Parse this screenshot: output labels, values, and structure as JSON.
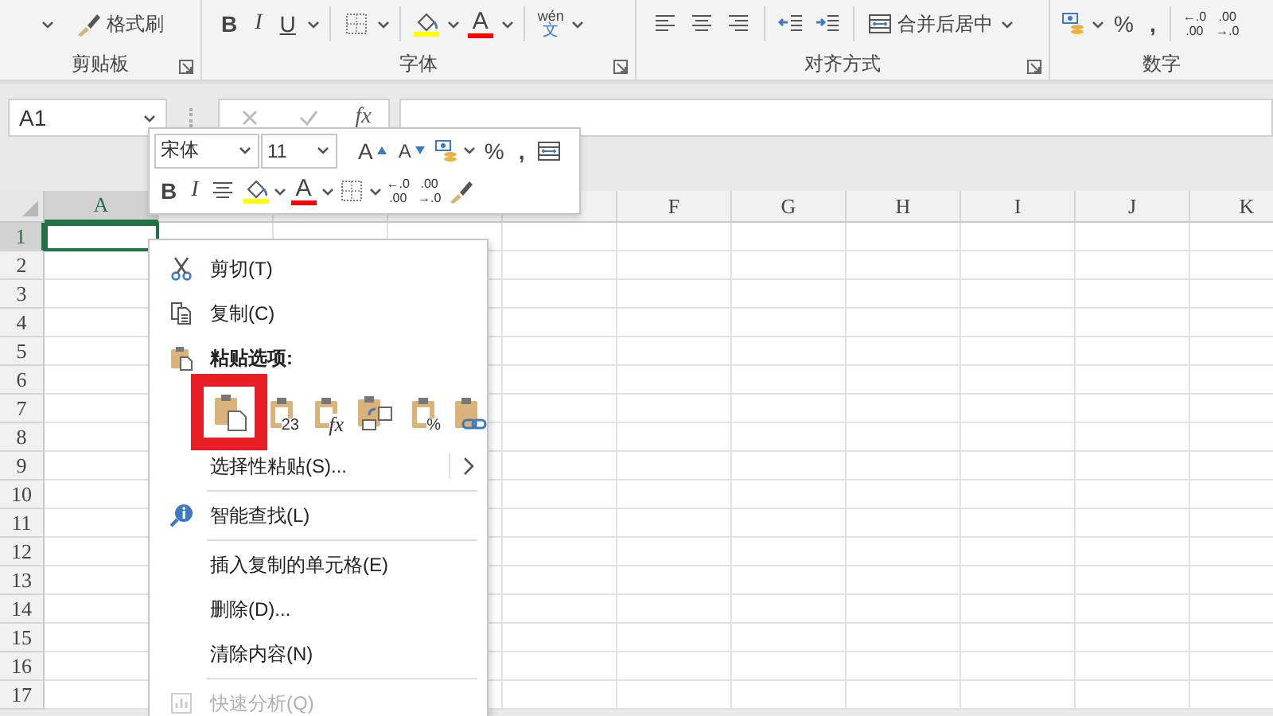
{
  "ribbon": {
    "groups": [
      {
        "label": "剪贴板",
        "launcher": true,
        "tools": [
          {
            "kind": "caret"
          },
          {
            "kind": "brush",
            "text": "格式刷"
          }
        ]
      },
      {
        "label": "字体",
        "launcher": true,
        "tools": [
          {
            "kind": "bold",
            "text": "B"
          },
          {
            "kind": "italic",
            "text": "I"
          },
          {
            "kind": "underline",
            "text": "U"
          },
          {
            "kind": "caret"
          },
          {
            "kind": "sep"
          },
          {
            "kind": "borders"
          },
          {
            "kind": "caret"
          },
          {
            "kind": "sep"
          },
          {
            "kind": "fill",
            "color": "#ffff00"
          },
          {
            "kind": "caret"
          },
          {
            "kind": "fontcolor",
            "text": "A",
            "color": "#ff0000"
          },
          {
            "kind": "caret"
          },
          {
            "kind": "sep"
          },
          {
            "kind": "phonetic",
            "text": "wén",
            "sub": "文"
          },
          {
            "kind": "caret"
          }
        ]
      },
      {
        "label": "对齐方式",
        "launcher": true,
        "tools": [
          {
            "kind": "align-left"
          },
          {
            "kind": "align-center"
          },
          {
            "kind": "align-right"
          },
          {
            "kind": "sep"
          },
          {
            "kind": "outdent"
          },
          {
            "kind": "indent"
          },
          {
            "kind": "sep"
          },
          {
            "kind": "merge",
            "text": "合并后居中"
          },
          {
            "kind": "caret"
          }
        ]
      },
      {
        "label": "数字",
        "launcher": false,
        "tools": [
          {
            "kind": "numformat"
          },
          {
            "kind": "caret"
          },
          {
            "kind": "percent",
            "text": "%"
          },
          {
            "kind": "comma",
            "text": ","
          },
          {
            "kind": "sep"
          },
          {
            "kind": "decimal",
            "top": "←.0",
            "bottom": ".00"
          },
          {
            "kind": "decimal",
            "top": ".00",
            "bottom": "→.0"
          }
        ]
      }
    ]
  },
  "formula_bar": {
    "name_box": "A1",
    "function_label": "fx"
  },
  "mini_toolbar": {
    "top_row": [
      {
        "kind": "combo",
        "text": "宋体"
      },
      {
        "kind": "combo",
        "text": "11"
      },
      {
        "kind": "grow",
        "text": "A"
      },
      {
        "kind": "shrink",
        "text": "A"
      },
      {
        "kind": "numformat"
      },
      {
        "kind": "caret"
      },
      {
        "kind": "percent",
        "text": "%"
      },
      {
        "kind": "comma",
        "text": ","
      },
      {
        "kind": "wrap"
      }
    ],
    "bottom_row": [
      {
        "kind": "bold",
        "text": "B"
      },
      {
        "kind": "italic",
        "text": "I"
      },
      {
        "kind": "align-center"
      },
      {
        "kind": "fill",
        "color": "#ffff00"
      },
      {
        "kind": "caret"
      },
      {
        "kind": "fontcolor",
        "text": "A",
        "color": "#ff0000"
      },
      {
        "kind": "caret"
      },
      {
        "kind": "borders"
      },
      {
        "kind": "caret"
      },
      {
        "kind": "decimal",
        "top": "←.0",
        "bottom": ".00"
      },
      {
        "kind": "decimal",
        "top": ".00",
        "bottom": "→.0"
      },
      {
        "kind": "brush"
      }
    ]
  },
  "sheet": {
    "columns": [
      {
        "label": "A",
        "selected": true
      },
      {
        "selected": false
      },
      {
        "selected": false
      },
      {
        "selected": false
      },
      {
        "selected": false
      },
      {
        "label": "F",
        "selected": false
      },
      {
        "label": "G",
        "selected": false
      },
      {
        "label": "H",
        "selected": false
      },
      {
        "label": "I",
        "selected": false
      },
      {
        "label": "J",
        "selected": false
      },
      {
        "label": "K",
        "selected": false
      }
    ],
    "rows": [
      {
        "label": "1",
        "selected": true
      },
      {
        "label": "2",
        "selected": false
      },
      {
        "label": "3",
        "selected": false
      },
      {
        "label": "4",
        "selected": false
      },
      {
        "label": "5",
        "selected": false
      },
      {
        "label": "6",
        "selected": false
      },
      {
        "label": "7",
        "selected": false
      },
      {
        "label": "8",
        "selected": false
      },
      {
        "label": "9",
        "selected": false
      },
      {
        "label": "10",
        "selected": false
      },
      {
        "label": "11",
        "selected": false
      },
      {
        "label": "12",
        "selected": false
      },
      {
        "label": "13",
        "selected": false
      },
      {
        "label": "14",
        "selected": false
      },
      {
        "label": "15",
        "selected": false
      },
      {
        "label": "16",
        "selected": false
      },
      {
        "label": "17",
        "selected": false
      }
    ]
  },
  "context_menu": {
    "items": [
      {
        "kind": "cut",
        "text": "剪切(T)",
        "submenu": false,
        "disabled": false
      },
      {
        "kind": "copy",
        "text": "复制(C)",
        "submenu": false,
        "disabled": false
      },
      {
        "kind": "heading",
        "text": "粘贴选项:"
      },
      {
        "kind": "paste_options",
        "options": [
          {
            "kind": "paste",
            "highlighted": true
          },
          {
            "kind": "values",
            "text": "23",
            "highlighted": false
          },
          {
            "kind": "formulas",
            "text": "fx",
            "highlighted": false
          },
          {
            "kind": "transpose",
            "highlighted": false
          },
          {
            "kind": "formatting",
            "text": "%",
            "highlighted": false
          },
          {
            "kind": "link",
            "highlighted": false
          }
        ]
      },
      {
        "kind": "plain",
        "text": "选择性粘贴(S)...",
        "submenu": true,
        "disabled": false
      },
      {
        "kind": "separator"
      },
      {
        "kind": "lookup",
        "text": "智能查找(L)",
        "submenu": false,
        "disabled": false
      },
      {
        "kind": "separator"
      },
      {
        "kind": "plain",
        "text": "插入复制的单元格(E)",
        "submenu": false,
        "disabled": false
      },
      {
        "kind": "plain",
        "text": "删除(D)...",
        "submenu": false,
        "disabled": false
      },
      {
        "kind": "plain",
        "text": "清除内容(N)",
        "submenu": false,
        "disabled": false
      },
      {
        "kind": "separator"
      },
      {
        "kind": "analysis",
        "text": "快速分析(Q)",
        "submenu": false,
        "disabled": true
      }
    ]
  }
}
